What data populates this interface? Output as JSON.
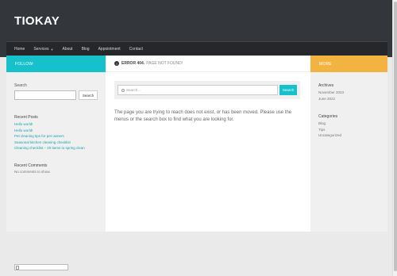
{
  "site": {
    "title": "TIOKAY"
  },
  "nav": {
    "items": [
      {
        "label": "Home"
      },
      {
        "label": "Services"
      },
      {
        "label": "About"
      },
      {
        "label": "Blog"
      },
      {
        "label": "Appointment"
      },
      {
        "label": "Contact"
      }
    ]
  },
  "sidebar_left": {
    "bar_label": "FOLLOW:",
    "search": {
      "title": "Search",
      "button_label": "Search",
      "value": ""
    },
    "recent_posts": {
      "heading": "Recent Posts",
      "items": [
        "Hello world!",
        "Hello world!",
        "Pet cleaning tips for pet owners",
        "Seasonal kitchen cleaning checklist",
        "Cleaning checklist – 20 items to spring clean"
      ]
    },
    "recent_comments": {
      "heading": "Recent Comments",
      "text": "No comments to show."
    }
  },
  "content": {
    "error_label": "ERROR 404.",
    "error_text": "PAGE NOT FOUND!",
    "search_placeholder": "Search...",
    "search_button": "Search",
    "message": "The page you are trying to reach does not exist, or has been moved. Please use the menus or the search box to find what you are looking for."
  },
  "sidebar_right": {
    "bar_label": "MORE",
    "archives": {
      "heading": "Archives",
      "items": [
        "November 2023",
        "June 2022"
      ]
    },
    "categories": {
      "heading": "Categories",
      "items": [
        "Blog",
        "Tips",
        "Uncategorized"
      ]
    }
  },
  "colors": {
    "accent_teal": "#16c1cb",
    "accent_orange": "#f3b340",
    "header_bg": "#33363b",
    "nav_bg": "#26272b"
  }
}
